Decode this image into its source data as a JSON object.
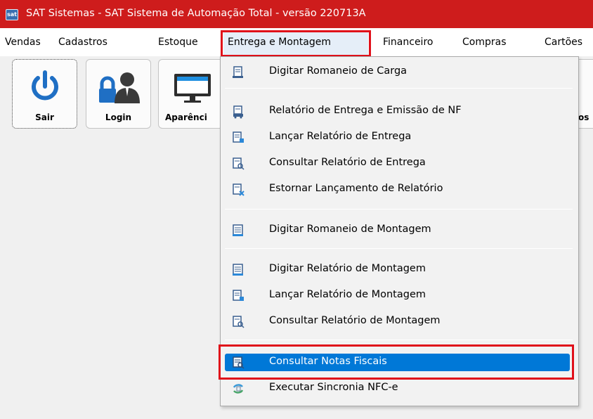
{
  "window": {
    "title": "SAT Sistemas - SAT Sistema de Automação Total - versão 220713A",
    "icon": "sat-app-icon",
    "icon_text": "sat",
    "title_bar_color": "#ce1c1c"
  },
  "menubar": {
    "items": [
      {
        "label": "Vendas"
      },
      {
        "label": "Cadastros"
      },
      {
        "label": "Estoque"
      },
      {
        "label": "Entrega e Montagem"
      },
      {
        "label": "Financeiro"
      },
      {
        "label": "Compras"
      },
      {
        "label": "Cartões"
      }
    ],
    "active": "Entrega e Montagem"
  },
  "toolbar": {
    "buttons": [
      {
        "label": "Sair",
        "icon": "power-icon"
      },
      {
        "label": "Login",
        "icon": "login-user-icon"
      },
      {
        "label": "Aparênci",
        "icon": "monitor-icon"
      },
      {
        "label": "os",
        "icon": "unknown-icon"
      }
    ]
  },
  "dropdown": {
    "items": [
      {
        "label": "Digitar Romaneio de Carga",
        "icon": "document-edit-icon"
      },
      {
        "label": "Relatório de Entrega e Emissão de NF",
        "icon": "document-truck-icon"
      },
      {
        "label": "Lançar Relatório de Entrega",
        "icon": "document-add-icon"
      },
      {
        "label": "Consultar Relatório de Entrega",
        "icon": "document-search-icon"
      },
      {
        "label": "Estornar Lançamento de Relatório",
        "icon": "document-cancel-icon"
      },
      {
        "label": "Digitar Romaneio de Montagem",
        "icon": "document-list-icon"
      },
      {
        "label": "Digitar Relatório de Montagem",
        "icon": "document-list-icon"
      },
      {
        "label": "Lançar Relatório de Montagem",
        "icon": "document-add-icon"
      },
      {
        "label": "Consultar Relatório de Montagem",
        "icon": "document-search-icon"
      },
      {
        "label": "Consultar Notas Fiscais",
        "icon": "invoice-search-icon"
      },
      {
        "label": "Executar Sincronia NFC-e",
        "icon": "sync-icon"
      }
    ],
    "selected": "Consultar Notas Fiscais"
  },
  "colors": {
    "highlight_border": "#e0101a",
    "selection": "#0078d7"
  }
}
